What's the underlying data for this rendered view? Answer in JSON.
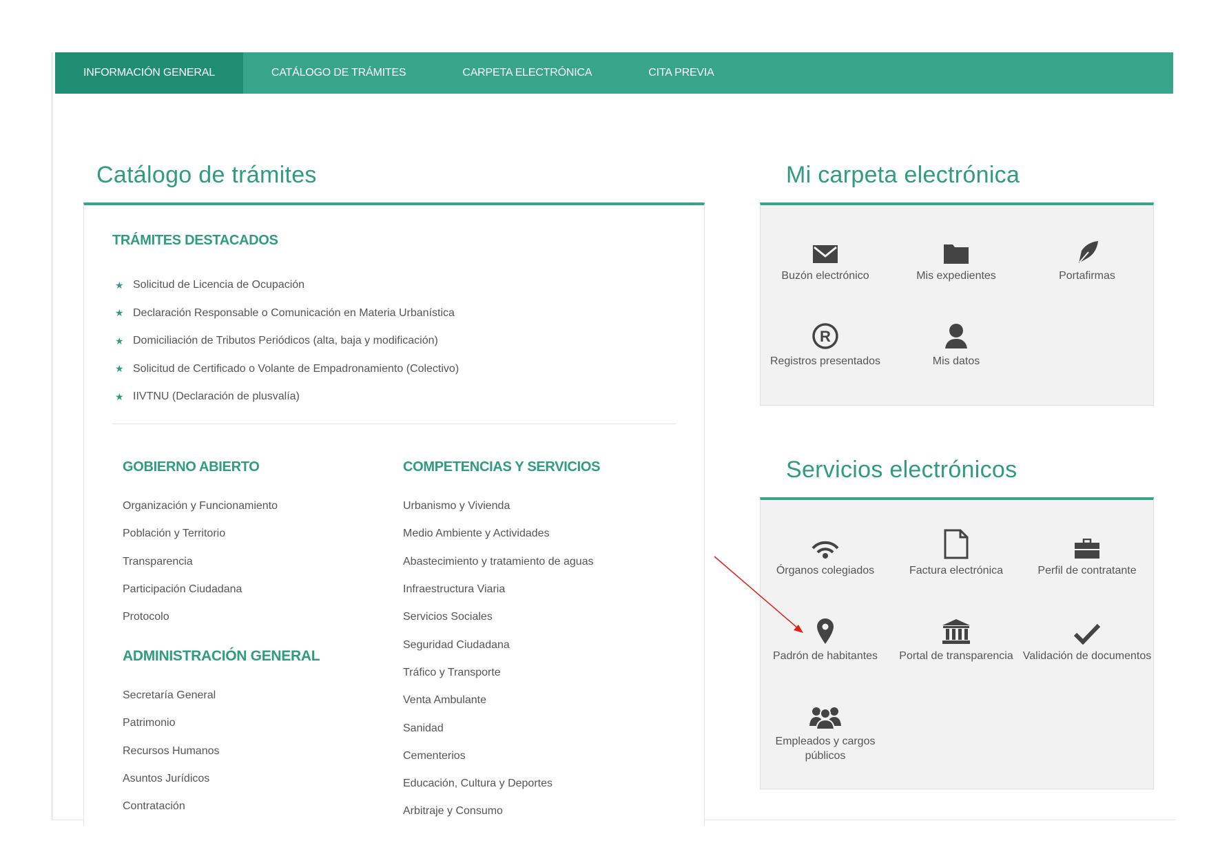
{
  "nav": {
    "items": [
      {
        "label": "INFORMACIÓN GENERAL",
        "active": true
      },
      {
        "label": "CATÁLOGO DE TRÁMITES",
        "active": false
      },
      {
        "label": "CARPETA ELECTRÓNICA",
        "active": false
      },
      {
        "label": "CITA PREVIA",
        "active": false
      }
    ]
  },
  "catalog": {
    "title": "Catálogo de trámites",
    "featured": {
      "heading": "TRÁMITES DESTACADOS",
      "items": [
        "Solicitud de Licencia de Ocupación",
        "Declaración Responsable o Comunicación en Materia Urbanística",
        "Domiciliación de Tributos Periódicos (alta, baja y modificación)",
        "Solicitud de Certificado o Volante de Empadronamiento (Colectivo)",
        "IIVTNU (Declaración de plusvalía)"
      ]
    },
    "open_gov": {
      "heading": "GOBIERNO ABIERTO",
      "items": [
        "Organización y Funcionamiento",
        "Población y Territorio",
        "Transparencia",
        "Participación Ciudadana",
        "Protocolo"
      ]
    },
    "general_admin": {
      "heading": "ADMINISTRACIÓN GENERAL",
      "items": [
        "Secretaría General",
        "Patrimonio",
        "Recursos Humanos",
        "Asuntos Jurídicos",
        "Contratación"
      ]
    },
    "services": {
      "heading": "COMPETENCIAS Y SERVICIOS",
      "items": [
        "Urbanismo y Vivienda",
        "Medio Ambiente y Actividades",
        "Abastecimiento y tratamiento de aguas",
        "Infraestructura Viaria",
        "Servicios Sociales",
        "Seguridad Ciudadana",
        "Tráfico y Transporte",
        "Venta Ambulante",
        "Sanidad",
        "Cementerios",
        "Educación, Cultura y Deportes",
        "Arbitraje y Consumo"
      ]
    }
  },
  "folder": {
    "title": "Mi carpeta electrónica",
    "tiles": [
      {
        "label": "Buzón electrónico",
        "icon": "envelope-icon"
      },
      {
        "label": "Mis expedientes",
        "icon": "folder-icon"
      },
      {
        "label": "Portafirmas",
        "icon": "pen-nib-icon"
      },
      {
        "label": "Registros presentados",
        "icon": "registered-icon"
      },
      {
        "label": "Mis datos",
        "icon": "user-icon"
      }
    ]
  },
  "eservices": {
    "title": "Servicios electrónicos",
    "tiles": [
      {
        "label": "Órganos colegiados",
        "icon": "broadcast-icon"
      },
      {
        "label": "Factura electrónica",
        "icon": "document-icon"
      },
      {
        "label": "Perfil de contratante",
        "icon": "briefcase-icon"
      },
      {
        "label": "Padrón de habitantes",
        "icon": "map-marker-icon"
      },
      {
        "label": "Portal de transparencia",
        "icon": "institution-icon"
      },
      {
        "label": "Validación de documentos",
        "icon": "checkmark-icon"
      },
      {
        "label": "Empleados y cargos públicos",
        "icon": "group-icon"
      }
    ]
  },
  "colors": {
    "brand": "#36a589",
    "brand_dark": "#1f8d72",
    "heading": "#2f9b81",
    "icon": "#444444",
    "annotation_arrow": "#e0201b"
  }
}
